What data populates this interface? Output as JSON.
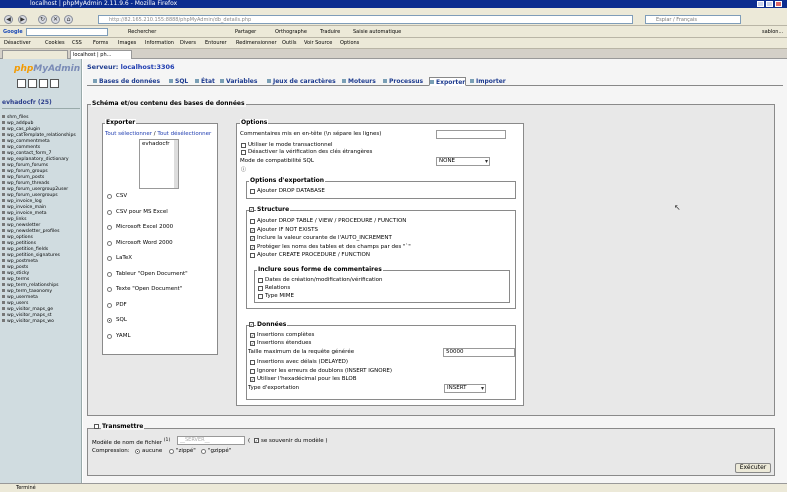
{
  "window": {
    "title": "localhost | phpMyAdmin 2.11.9.6 - Mozilla Firefox"
  },
  "browser": {
    "url": "http://82.165.210.155:8888/phpMyAdmin/db_details.php",
    "search_placeholder": "Google",
    "search_label": "Espiar / Français",
    "user": "sablon...",
    "google_bar": [
      "Google",
      "Rechercher",
      "Partager",
      "Orthographe",
      "Traduire",
      "Saisie automatique"
    ],
    "bookmarks": [
      "Désactiver",
      "Cookies",
      "CSS",
      "Forms",
      "Images",
      "Information",
      "Divers",
      "Entourer",
      "Redimensionner",
      "Outils",
      "Voir Source",
      "Options"
    ],
    "tab_label": "localhost | ph...",
    "status": "Terminé"
  },
  "sidebar": {
    "logo_php": "php",
    "logo_myadmin": "MyAdmin",
    "db_name": "evhadocfr (25)",
    "tables": [
      "shm_files",
      "wp_addpub",
      "wp_cas_plugin",
      "wp_catTemplate_relationships",
      "wp_commentmeta",
      "wp_comments",
      "wp_contact_form_7",
      "wp_explanatory_dictionary",
      "wp_forum_forums",
      "wp_forum_groups",
      "wp_forum_posts",
      "wp_forum_threads",
      "wp_forum_usergroup2user",
      "wp_forum_usergroups",
      "wp_invoice_log",
      "wp_invoice_main",
      "wp_invoice_meta",
      "wp_links",
      "wp_newsletter",
      "wp_newsletter_profiles",
      "wp_options",
      "wp_petitions",
      "wp_petition_fields",
      "wp_petition_signatures",
      "wp_postmeta",
      "wp_posts",
      "wp_sticky",
      "wp_terms",
      "wp_term_relationships",
      "wp_term_taxonomy",
      "wp_usermeta",
      "wp_users",
      "wp_visitor_maps_ge",
      "wp_visitor_maps_st",
      "wp_visitor_maps_wo"
    ]
  },
  "server": {
    "label": "Serveur:",
    "name": "localhost:3306"
  },
  "server_tabs": [
    "Bases de données",
    "SQL",
    "État",
    "Variables",
    "Jeux de caractères",
    "Moteurs",
    "Processus",
    "Exporter",
    "Importer"
  ],
  "export": {
    "main_legend": "Schéma et/ou contenu des bases de données",
    "exporter_legend": "Exporter",
    "select_all": "Tout sélectionner",
    "separator": " / ",
    "deselect_all": "Tout désélectionner",
    "db_list": [
      "evhadocfr"
    ],
    "formats": [
      "CSV",
      "CSV pour MS Excel",
      "Microsoft Excel 2000",
      "Microsoft Word 2000",
      "LaTeX",
      "Tableur \"Open Document\"",
      "Texte \"Open Document\"",
      "PDF",
      "SQL",
      "YAML"
    ],
    "selected_format": "SQL",
    "options_legend": "Options",
    "header_comments": "Commentaires mis en en-tête (\\n sépare les lignes)",
    "transactional": "Utiliser le mode transactionnel",
    "disable_fk": "Désactiver la vérification des clés étrangères",
    "compat_mode": "Mode de compatibilité SQL",
    "compat_value": "NONE",
    "export_options_legend": "Options d'exportation",
    "drop_database": "Ajouter DROP DATABASE",
    "structure_legend": "Structure",
    "structure_opts": [
      {
        "label": "Ajouter DROP TABLE / VIEW / PROCEDURE / FUNCTION",
        "checked": false
      },
      {
        "label": "Ajouter IF NOT EXISTS",
        "checked": true
      },
      {
        "label": "Inclure la valeur courante de l'AUTO_INCREMENT",
        "checked": true
      },
      {
        "label": "Protéger les noms des tables et des champs par des \"`\"",
        "checked": true
      },
      {
        "label": "Ajouter CREATE PROCEDURE / FUNCTION",
        "checked": false
      }
    ],
    "comments_legend": "Inclure sous forme de commentaires",
    "comment_opts": [
      "Dates de création/modification/vérification",
      "Relations",
      "Type MIME"
    ],
    "data_legend": "Données",
    "data_opts": [
      {
        "label": "Insertions complètes",
        "checked": true
      },
      {
        "label": "Insertions étendues",
        "checked": true
      }
    ],
    "max_query": "Taille maximum de la requête générée",
    "max_query_value": "50000",
    "data_opts2": [
      {
        "label": "Insertions avec délais (DELAYED)",
        "checked": false
      },
      {
        "label": "Ignorer les erreurs de doublons (INSERT IGNORE)",
        "checked": false
      },
      {
        "label": "Utiliser l'hexadécimal pour les BLOB",
        "checked": true
      }
    ],
    "export_type": "Type d'exportation",
    "export_type_value": "INSERT"
  },
  "transmit": {
    "legend": "Transmettre",
    "template_label": "Modèle de nom de fichier",
    "template_sup": "(1)",
    "template_value": "__SERVER__",
    "remember_open": "(",
    "remember": "se souvenir du modèle",
    "remember_close": ")",
    "compression": "Compression:",
    "opts": [
      "aucune",
      "\"zippé\"",
      "\"gzippé\""
    ],
    "execute": "Exécuter"
  },
  "colors": {
    "titlebar": "#0b2c8f",
    "link": "#1d3bb0",
    "sidebar": "#d0dce0"
  }
}
